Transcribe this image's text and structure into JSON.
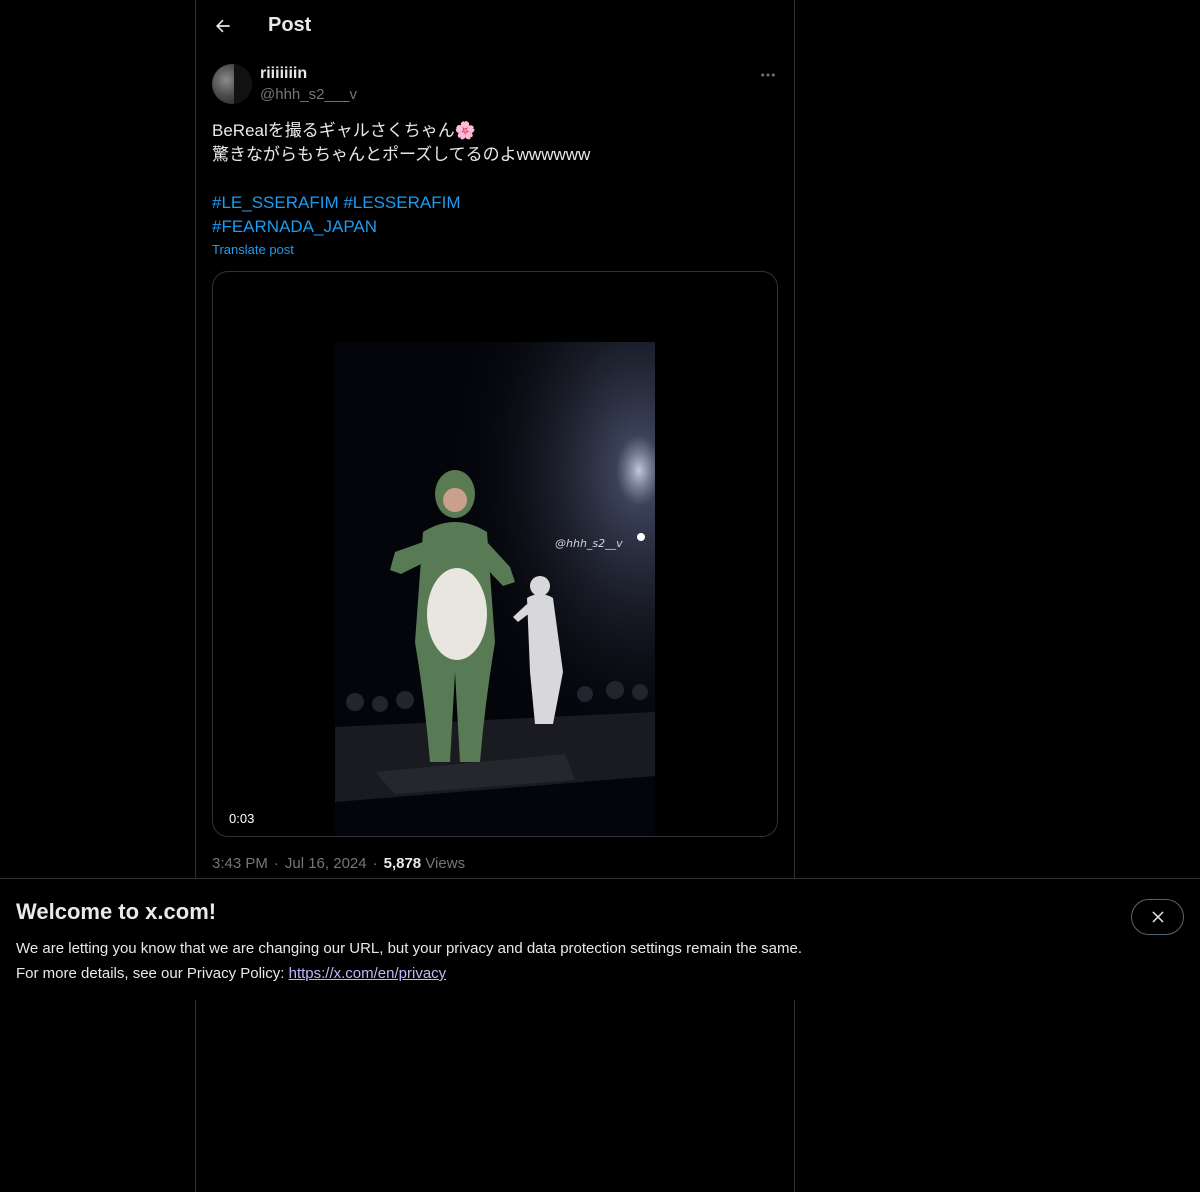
{
  "header": {
    "title": "Post",
    "back_icon": "arrow-left-icon"
  },
  "author": {
    "display_name": "riiiiiiin",
    "handle": "@hhh_s2___v",
    "more_icon": "more-horizontal-icon"
  },
  "post": {
    "text_line1": "BeRealを撮るギャルさくちゃん🌸",
    "text_line2": "驚きながらもちゃんとポーズしてるのよwwwwww",
    "hashtag1": "#LE_SSERAFIM",
    "hashtag2": "#LESSERAFIM",
    "hashtag3": "#FEARNADA_JAPAN",
    "translate_label": "Translate post"
  },
  "media": {
    "type": "video",
    "duration": "0:03",
    "watermark": "@hhh_s2__v"
  },
  "meta": {
    "time": "3:43 PM",
    "date": "Jul 16, 2024",
    "views_count": "5,878",
    "views_label": "Views",
    "separator": "·"
  },
  "banner": {
    "title": "Welcome to x.com!",
    "text1": "We are letting you know that we are changing our URL, but your privacy and data protection settings remain the same.",
    "text2": "For more details, see our Privacy Policy:",
    "link": "https://x.com/en/privacy",
    "close_icon": "close-icon"
  },
  "colors": {
    "background": "#000000",
    "text": "#e7e9ea",
    "muted": "#71767b",
    "accent": "#1d9bf0",
    "border": "#2f3336"
  }
}
